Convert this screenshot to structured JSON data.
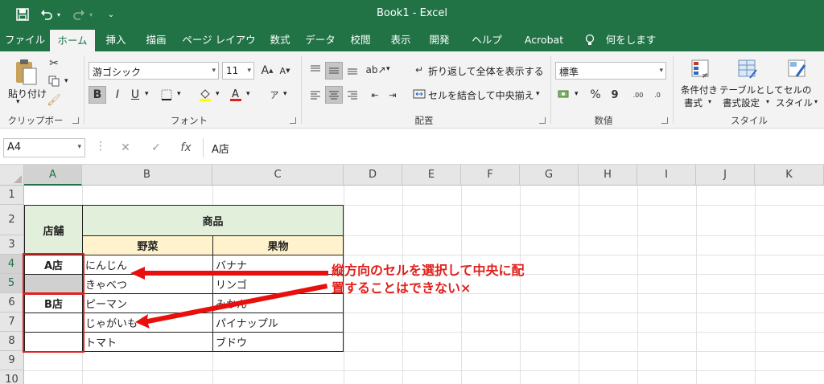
{
  "window": {
    "title": "Book1  -  Excel"
  },
  "ribbon_tabs": [
    "ファイル",
    "ホーム",
    "挿入",
    "描画",
    "ページ レイアウト",
    "数式",
    "データ",
    "校閲",
    "表示",
    "開発",
    "ヘルプ",
    "Acrobat",
    "何をしますか"
  ],
  "ribbon": {
    "clipboard": {
      "paste_label": "貼り付け",
      "group_label": "クリップボード"
    },
    "font": {
      "font_name": "游ゴシック",
      "font_size": "11",
      "group_label": "フォント",
      "bold": "B",
      "italic": "I",
      "underline": "U",
      "grow": "A",
      "shrink": "A"
    },
    "alignment": {
      "wrap_label": "折り返して全体を表示する",
      "merge_label": "セルを結合して中央揃え",
      "group_label": "配置"
    },
    "number": {
      "format": "標準",
      "percent": "%",
      "comma": "9",
      "inc_decimal": ".00",
      "dec_decimal": ".0",
      "group_label": "数値"
    },
    "styles": {
      "conditional_label_1": "条件付き",
      "conditional_label_2": "書式",
      "table_label_1": "テーブルとして",
      "table_label_2": "書式設定",
      "cell_label_1": "セルの",
      "cell_label_2": "スタイル",
      "group_label": "スタイル"
    }
  },
  "formula_bar": {
    "name_box": "A4",
    "cancel": "✕",
    "enter": "✓",
    "fx": "fx",
    "formula": "A店"
  },
  "columns": [
    "A",
    "B",
    "C",
    "D",
    "E",
    "F",
    "G",
    "H",
    "I",
    "J",
    "K"
  ],
  "rows": [
    "1",
    "2",
    "3",
    "4",
    "5",
    "6",
    "7",
    "8",
    "9",
    "10"
  ],
  "table": {
    "store_header": "店舗",
    "product_header": "商品",
    "veg_header": "野菜",
    "fruit_header": "果物",
    "store_a": "A店",
    "store_b": "B店",
    "vegetables": [
      "にんじん",
      "きゃべつ",
      "ピーマン",
      "じゃがいも",
      "トマト"
    ],
    "fruits": [
      "バナナ",
      "リンゴ",
      "みかん",
      "パイナップル",
      "ブドウ"
    ]
  },
  "annotation": {
    "line1": "縦方向のセルを選択して中央に配",
    "line2": "置することはできない×",
    "color": "#e0201c"
  },
  "colors": {
    "excel_green": "#217346",
    "header_green": "#e2efda",
    "header_yellow": "#fff2cc",
    "selected_gray": "#d0d0d0"
  }
}
